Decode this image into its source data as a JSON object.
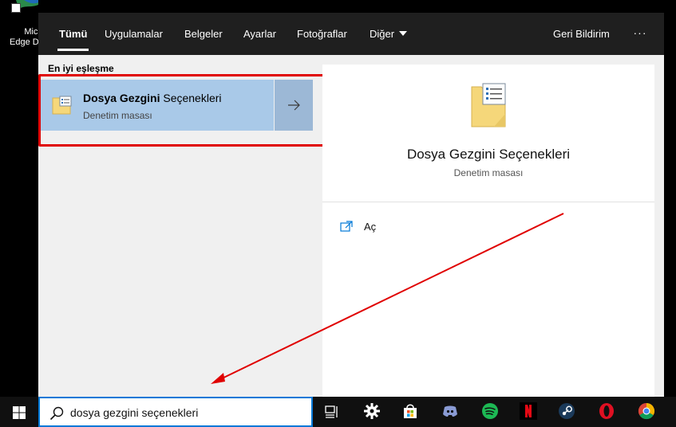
{
  "desktop": {
    "icon_label": "Micros\nEdge D"
  },
  "tabs": [
    {
      "label": "Tümü",
      "active": true
    },
    {
      "label": "Uygulamalar"
    },
    {
      "label": "Belgeler"
    },
    {
      "label": "Ayarlar"
    },
    {
      "label": "Fotoğraflar"
    },
    {
      "label": "Diğer",
      "has_dropdown": true
    }
  ],
  "feedback_label": "Geri Bildirim",
  "more_label": "···",
  "best_match": {
    "section_label": "En iyi eşleşme",
    "title_bold": "Dosya Gezgini",
    "title_rest": " Seçenekleri",
    "subtitle": "Denetim masası"
  },
  "detail": {
    "title": "Dosya Gezgini Seçenekleri",
    "subtitle": "Denetim masası",
    "action_label": "Aç"
  },
  "search": {
    "query": "dosya gezgini seçenekleri"
  },
  "taskbar_apps": [
    "task-view",
    "settings",
    "microsoft-store",
    "discord",
    "spotify",
    "netflix",
    "steam",
    "opera",
    "chrome"
  ],
  "colors": {
    "accent": "#0078d7",
    "selected_bg": "#a9c9e8",
    "annotation": "#e00000"
  }
}
